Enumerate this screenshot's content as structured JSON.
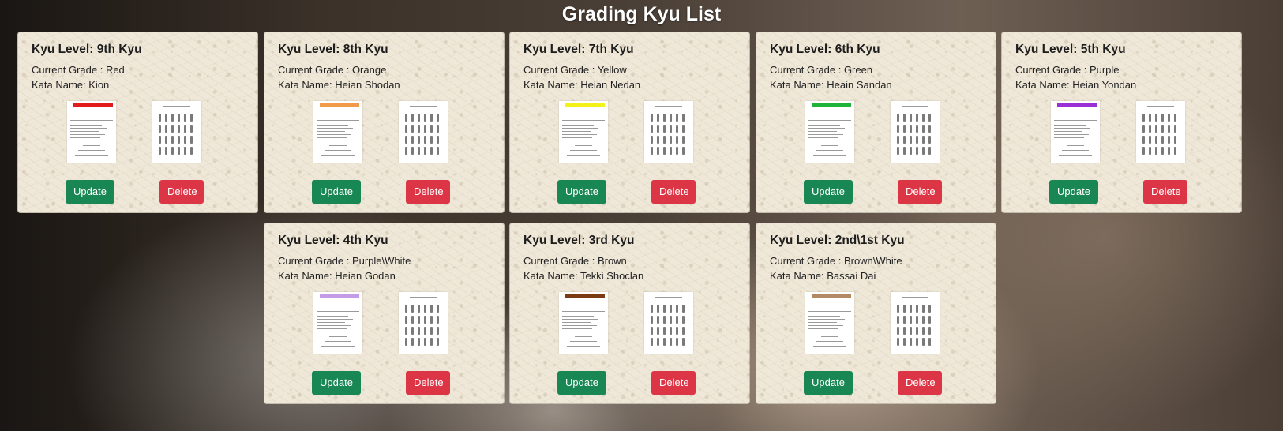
{
  "page": {
    "title": "Grading Kyu List"
  },
  "labels": {
    "kyu_prefix": "Kyu Level: ",
    "grade_prefix": "Current Grade : ",
    "kata_prefix": "Kata Name: ",
    "update": "Update",
    "delete": "Delete"
  },
  "cards": [
    {
      "kyu": "9th Kyu",
      "grade": "Red",
      "kata": "Kion",
      "belt_color": "#e21b1b"
    },
    {
      "kyu": "8th Kyu",
      "grade": "Orange",
      "kata": "Heian Shodan",
      "belt_color": "#f19a4a"
    },
    {
      "kyu": "7th Kyu",
      "grade": "Yellow",
      "kata": "Heian Nedan",
      "belt_color": "#f3f01a"
    },
    {
      "kyu": "6th Kyu",
      "grade": "Green",
      "kata": "Heain Sandan",
      "belt_color": "#1fb33a"
    },
    {
      "kyu": "5th Kyu",
      "grade": "Purple",
      "kata": "Heian Yondan",
      "belt_color": "#9b2fd6"
    },
    {
      "kyu": "4th Kyu",
      "grade": "Purple\\White",
      "kata": "Heian Godan",
      "belt_color": "#c49be6"
    },
    {
      "kyu": "3rd Kyu",
      "grade": "Brown",
      "kata": "Tekki Shoclan",
      "belt_color": "#7a3b12"
    },
    {
      "kyu": "2nd\\1st Kyu",
      "grade": "Brown\\White",
      "kata": "Bassai Dai",
      "belt_color": "#b48a66"
    }
  ],
  "colors": {
    "update": "#198754",
    "delete": "#dc3545"
  }
}
